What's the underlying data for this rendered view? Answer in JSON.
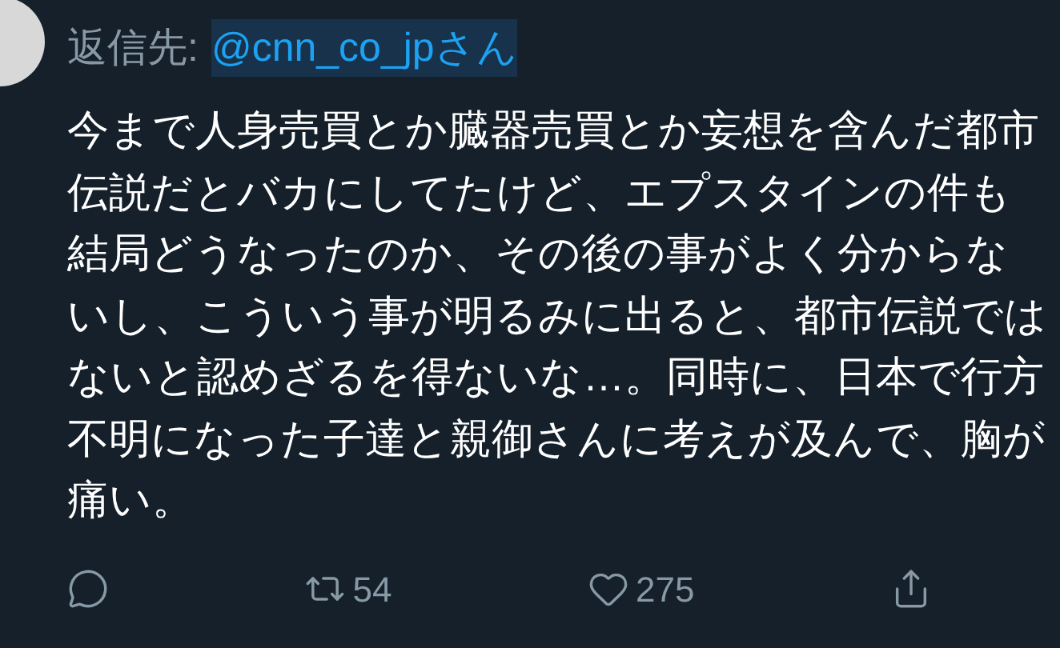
{
  "reply_to": {
    "label": "返信先:",
    "handle": "@cnn_co_jpさん"
  },
  "body": "今まで人身売買とか臓器売買とか妄想を含んだ都市伝説だとバカにしてたけど、エプスタインの件も結局どうなったのか、その後の事がよく分からないし、こういう事が明るみに出ると、都市伝説ではないと認めざるを得ないな…。同時に、日本で行方不明になった子達と親御さんに考えが及んで、胸が痛い。",
  "actions": [
    {
      "kind": "reply"
    },
    {
      "kind": "retweet",
      "count": "54"
    },
    {
      "kind": "like",
      "count": "275"
    },
    {
      "kind": "share"
    }
  ]
}
